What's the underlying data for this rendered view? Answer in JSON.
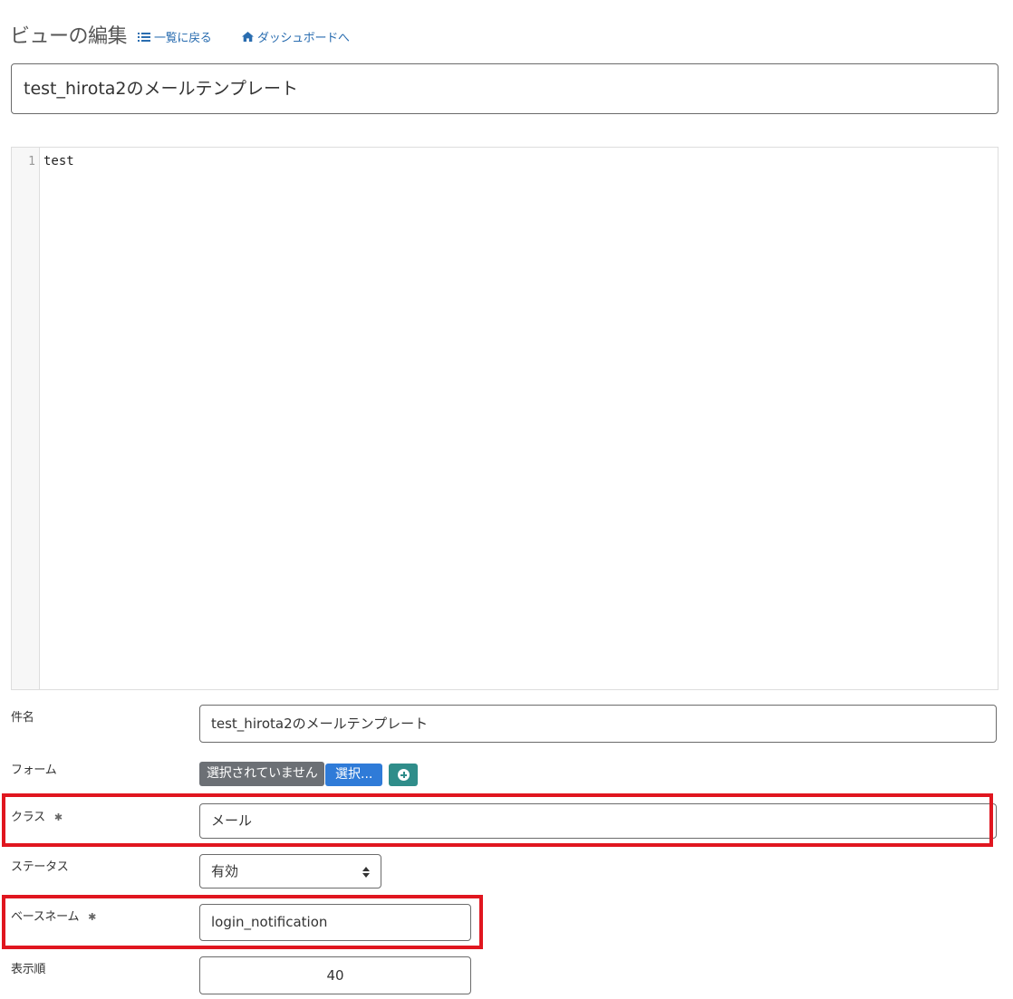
{
  "header": {
    "title": "ビューの編集",
    "back_to_list": "一覧に戻る",
    "to_dashboard": "ダッシュボードへ"
  },
  "title_field": {
    "value": "test_hirota2のメールテンプレート"
  },
  "editor": {
    "line_number": "1",
    "line_text": "test"
  },
  "form": {
    "subject": {
      "label": "件名",
      "value": "test_hirota2のメールテンプレート"
    },
    "form_select": {
      "label": "フォーム",
      "none_label": "選択されていません",
      "select_button": "選択..."
    },
    "class": {
      "label": "クラス",
      "required_mark": "✱",
      "value": "メール"
    },
    "status": {
      "label": "ステータス",
      "value": "有効"
    },
    "base_name": {
      "label": "ベースネーム",
      "required_mark": "✱",
      "value": "login_notification"
    },
    "display_order": {
      "label": "表示順",
      "value": "40"
    }
  },
  "colors": {
    "link": "#2a6db0",
    "highlight": "#e0161f",
    "select_button": "#2f7bd8",
    "add_button": "#2f8d8a",
    "none_badge": "#6c7075"
  }
}
